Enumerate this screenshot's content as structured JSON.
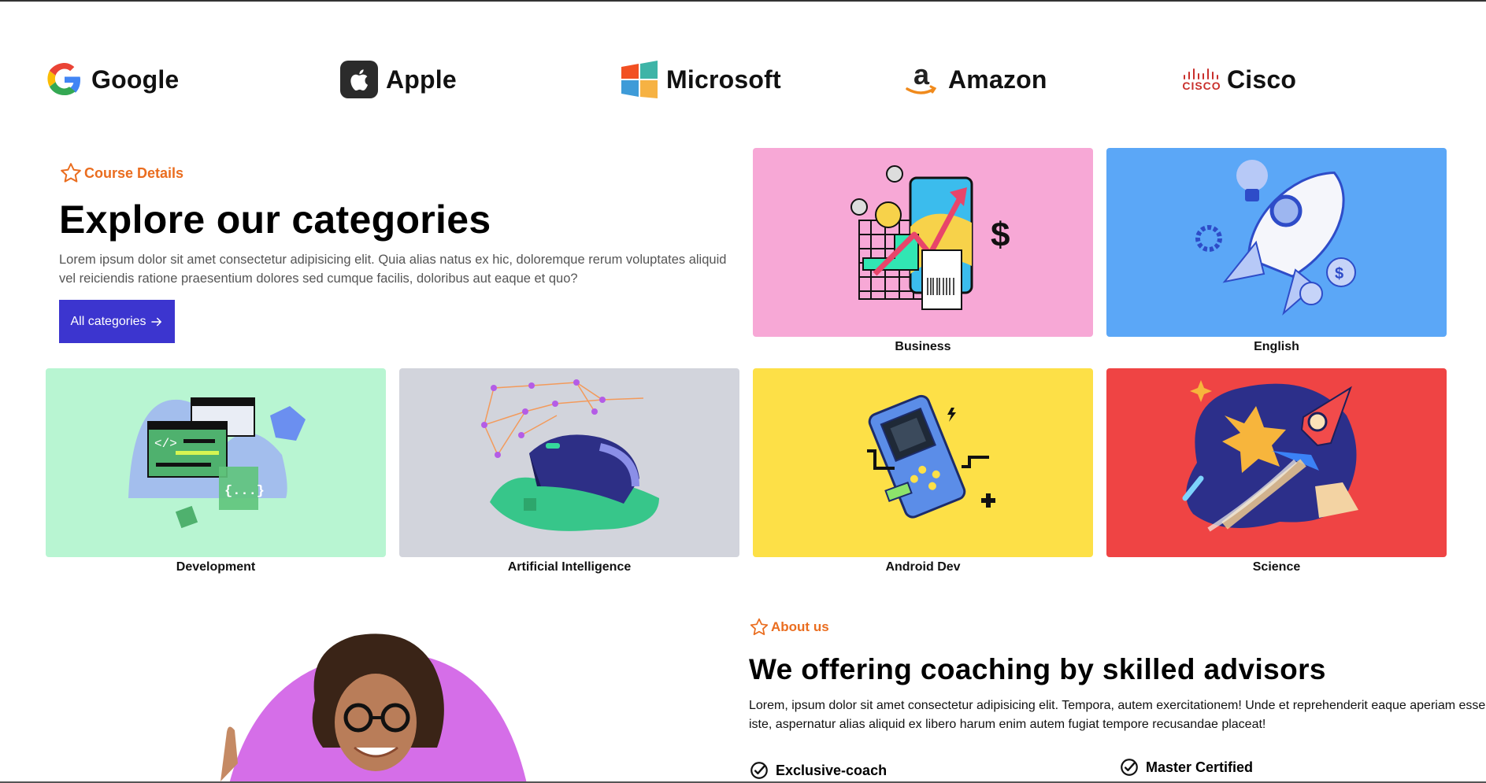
{
  "brands": [
    {
      "name": "Google",
      "icon": "google-logo-icon"
    },
    {
      "name": "Apple",
      "icon": "apple-logo-icon"
    },
    {
      "name": "Microsoft",
      "icon": "microsoft-logo-icon"
    },
    {
      "name": "Amazon",
      "icon": "amazon-logo-icon"
    },
    {
      "name": "Cisco",
      "icon": "cisco-logo-icon",
      "logo_text": "CISCO"
    }
  ],
  "categories_section": {
    "eyebrow": "Course Details",
    "title": "Explore our categories",
    "description": "Lorem ipsum dolor sit amet consectetur adipisicing elit. Quia alias natus ex hic, doloremque rerum voluptates aliquid vel reiciendis ratione praesentium dolores sed cumque facilis, doloribus aut eaque et quo?",
    "button_label": "All categories",
    "button_icon": "arrow-right-icon",
    "accent": "#ea6d1f",
    "button_color": "#3c35cf"
  },
  "categories": [
    {
      "label": "Business",
      "bg": "#f7a8d6"
    },
    {
      "label": "English",
      "bg": "#5ba7f7"
    },
    {
      "label": "Development",
      "bg": "#b8f5d2"
    },
    {
      "label": "Artificial Intelligence",
      "bg": "#d2d4dc"
    },
    {
      "label": "Android Dev",
      "bg": "#fde047"
    },
    {
      "label": "Science",
      "bg": "#ef4444"
    }
  ],
  "about_section": {
    "eyebrow": "About us",
    "title": "We offering coaching by skilled advisors",
    "description": "Lorem, ipsum dolor sit amet consectetur adipisicing elit. Tempora, autem exercitationem! Unde et reprehenderit eaque aperiam esse iste, aspernatur alias aliquid ex libero harum enim autem fugiat tempore recusandae placeat!",
    "features": [
      "Exclusive-coach",
      "Master Certified"
    ],
    "hero_blob_color": "#d56ee8"
  }
}
